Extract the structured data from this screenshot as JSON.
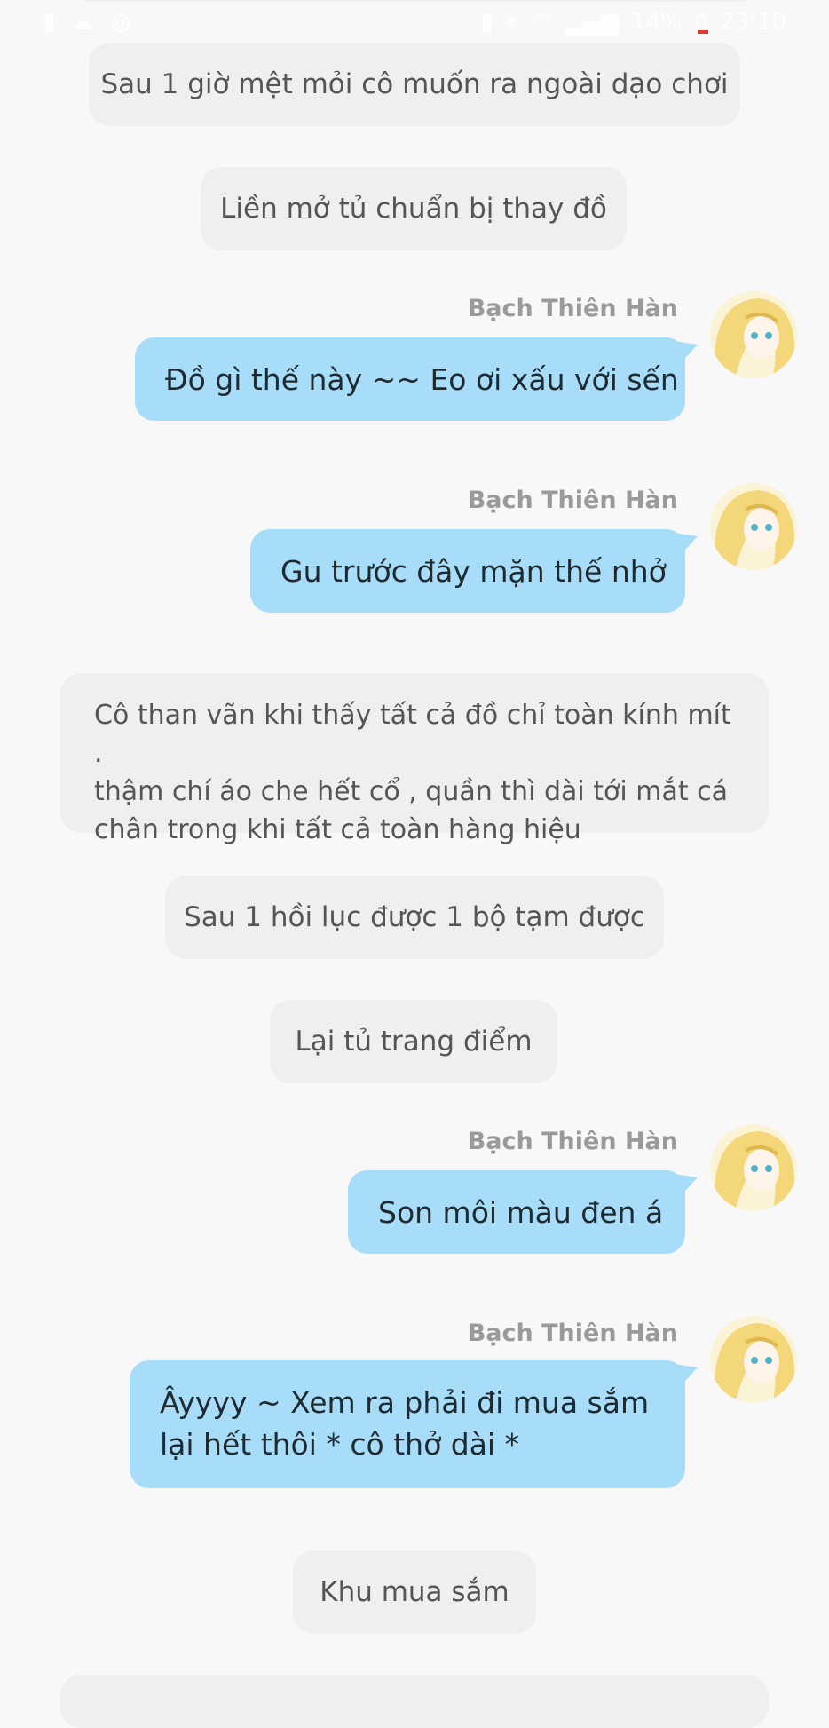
{
  "status_bar": {
    "left_icons": [
      "battery-saver-icon",
      "cloud-icon",
      "instagram-icon"
    ],
    "right_icons": [
      "sim-icon",
      "mute-icon",
      "wifi-icon",
      "signal-icon"
    ],
    "battery": "14%",
    "time": "23:10",
    "colors": {
      "text": "#ffffff",
      "low_battery": "#e53935"
    }
  },
  "chat": {
    "colors": {
      "background": "#f8f8f8",
      "narration_bg": "#efefef",
      "narration_text": "#555555",
      "bubble_bg": "#a8ddf9",
      "bubble_text": "#1f2a30",
      "name_text": "#9a9a9a"
    },
    "messages": [
      {
        "type": "narration",
        "text": "Sau 1 giờ mệt mỏi cô muốn ra ngoài dạo chơi"
      },
      {
        "type": "narration",
        "text": "Liền mở tủ chuẩn bị thay đồ"
      },
      {
        "type": "character",
        "name": "Bạch Thiên Hàn",
        "avatar": "avatar-anime-girl",
        "text": "Đồ gì thế này ~~ Eo ơi xấu với sến"
      },
      {
        "type": "character",
        "name": "Bạch Thiên Hàn",
        "avatar": "avatar-anime-girl",
        "text": "Gu trước đây mặn thế nhở"
      },
      {
        "type": "narration",
        "lines": [
          "Cô than vãn khi thấy tất cả đồ chỉ toàn kính mít .",
          "thậm chí áo che hết cổ , quần thì dài tới mắt cá",
          "chân trong khi tất cả toàn hàng hiệu"
        ]
      },
      {
        "type": "narration",
        "text": "Sau 1 hồi lục được 1 bộ tạm được"
      },
      {
        "type": "narration",
        "text": "Lại tủ trang điểm"
      },
      {
        "type": "character",
        "name": "Bạch Thiên Hàn",
        "avatar": "avatar-anime-girl",
        "text": "Son môi màu đen á"
      },
      {
        "type": "character",
        "name": "Bạch Thiên Hàn",
        "avatar": "avatar-anime-girl",
        "lines": [
          "Âyyyy ~ Xem ra phải đi mua sắm",
          "lại hết thôi * cô thở dài *"
        ]
      },
      {
        "type": "narration",
        "text": "Khu mua sắm"
      }
    ]
  }
}
